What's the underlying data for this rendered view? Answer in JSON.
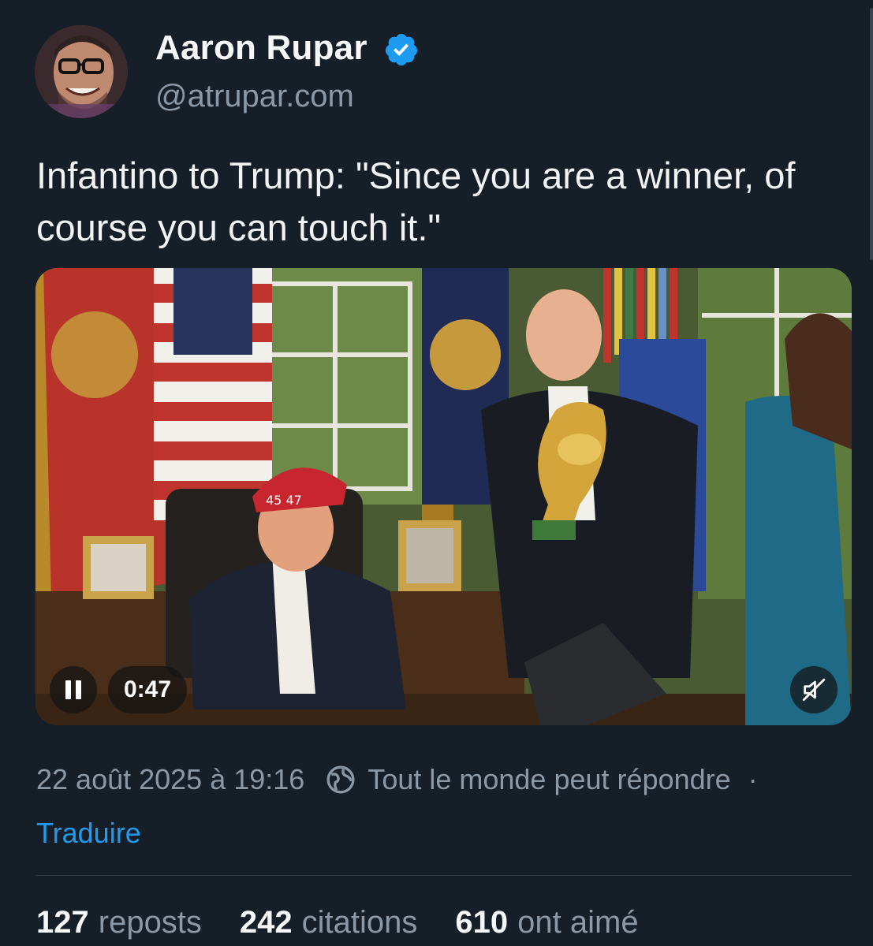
{
  "author": {
    "name": "Aaron Rupar",
    "handle": "@atrupar.com",
    "verified": true,
    "verified_color": "#1d9bf0"
  },
  "post": {
    "text": "Infantino to Trump: \"Since you are a winner, of course you can touch it.\""
  },
  "video": {
    "state": "playing",
    "elapsed": "0:47",
    "muted": true,
    "cap_text": "45 47"
  },
  "meta": {
    "timestamp": "22 août 2025 à 19:16",
    "reply_setting": "Tout le monde peut répondre",
    "separator": "·",
    "translate_label": "Traduire"
  },
  "stats": [
    {
      "count": "127",
      "label": "reposts"
    },
    {
      "count": "242",
      "label": "citations"
    },
    {
      "count": "610",
      "label": "ont aimé"
    }
  ],
  "colors": {
    "background": "#161e27",
    "link": "#1d9bf0",
    "secondary_text": "#8b98a5"
  }
}
